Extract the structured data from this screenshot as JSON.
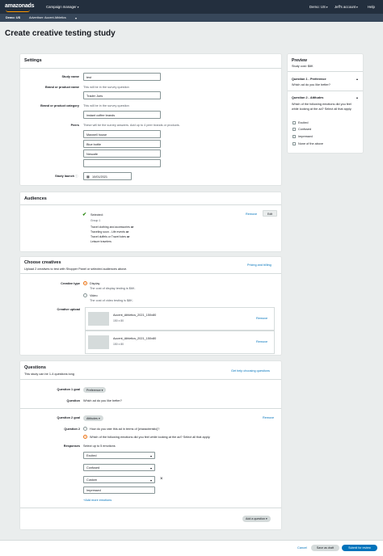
{
  "topbar": {
    "logo": "amazonads",
    "campaign_manager": "Campaign manager",
    "account": "Demo: US",
    "user": "Jeff's account",
    "help": "Help"
  },
  "subbar": {
    "country": "Demo: US",
    "advertiser": "Advertiser: Accent Athletics"
  },
  "page": {
    "title": "Create creative testing study"
  },
  "settings": {
    "title": "Settings",
    "study_name_label": "Study name",
    "study_name": "test",
    "brand_label": "Brand or product name",
    "brand_help": "This will be in the survey question",
    "brand_value": "Trader Joes",
    "category_label": "Brand or product category",
    "category_help": "This will be in the survey question",
    "category_value": "instant coffee brands",
    "peers_label": "Peers",
    "peers_help": "These will be the survey answers. Add up to 4 peer brands or products.",
    "peers": [
      "Maxwell house",
      "Blue bottle",
      "Nescafe",
      ""
    ],
    "launch_label": "Study launch",
    "launch_date": "10/01/2021"
  },
  "preview": {
    "title": "Preview",
    "cost": "Study cost: $6K",
    "q1_title": "Question 1 - Preference",
    "q1_text": "Which ad do you like better?",
    "q2_title": "Question 2 - Attitudes",
    "q2_text": "Which of the following emotions did you feel while looking at the ad? Select all that apply.",
    "q2_options": [
      "Excited",
      "Confused",
      "Impressed",
      "None of the above"
    ]
  },
  "audiences": {
    "title": "Audiences",
    "selected": "Selected:",
    "group": "Group 1",
    "items": [
      {
        "text": "Travel clothing and accessories",
        "op": "or"
      },
      {
        "text": "Traveling soon - Life events",
        "op": "or"
      },
      {
        "text": "Travel duffels or Travel totes",
        "op": "or"
      },
      {
        "text": "Leisure travelers",
        "op": ""
      }
    ],
    "remove": "Remove",
    "edit": "Edit"
  },
  "creatives": {
    "title": "Choose creatives",
    "subtitle": "Upload 2 creatives to test with Shopper Panel or selected audiences above.",
    "pricing_link": "Pricing and billing",
    "type_label": "Creative type",
    "display": "Display",
    "display_cost": "The cost of display testing is $6K.",
    "video": "Video",
    "video_cost": "The cost of video testing is $8K.",
    "upload_label": "Creative upload",
    "files": [
      {
        "name": "Accent_Athletics_2021_150x80",
        "size": "150 x 80",
        "remove": "Remove"
      },
      {
        "name": "Accent_Athletics_2021_150x80",
        "size": "150 x 80",
        "remove": "Remove"
      }
    ]
  },
  "questions": {
    "title": "Questions",
    "subtitle": "This study can be 1-4 questions long",
    "help_link": "Get help choosing questions",
    "q1_goal_label": "Question 1 goal",
    "q1_goal": "Preference",
    "q1_label": "Question",
    "q1_text": "Which ad do you like better?",
    "q2_goal_label": "Question 2 goal",
    "q2_goal": "Attitudes",
    "q2_remove": "Remove",
    "q2_label": "Question 2",
    "q2_opt1": "How do you rate this ad in terms of [characteristic]?",
    "q2_opt2": "Which of the following emotions did you feel while looking at the ad? Select all that apply.",
    "responses_label": "Responses",
    "responses_help": "Select up to 5 emotions",
    "responses": [
      "Excited",
      "Confused",
      "Custom"
    ],
    "custom_value": "Impressed",
    "add_emotions": "+Add more emotions",
    "add_question": "Add a question"
  },
  "footer": {
    "cancel": "Cancel",
    "save_draft": "Save as draft",
    "submit": "Submit for review"
  },
  "colors": {
    "topbar": "#232f3e",
    "subbar": "#37475a",
    "accent": "#ec7211",
    "submit": "#0073bb",
    "link": "#0073bb",
    "check": "#1d8102"
  }
}
